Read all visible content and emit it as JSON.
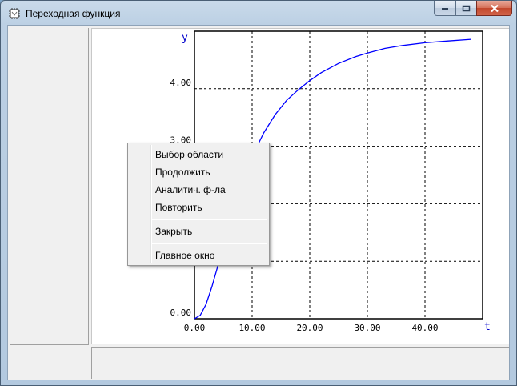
{
  "window": {
    "title": "Переходная функция",
    "icon": "chip-app-icon",
    "controls": [
      "minimize-icon",
      "maximize-icon",
      "close-icon"
    ]
  },
  "chart_data": {
    "type": "line",
    "xlabel": "t",
    "ylabel": "y",
    "xlim": [
      0,
      50
    ],
    "ylim": [
      0,
      5
    ],
    "x_ticks": [
      "0.00",
      "10.00",
      "20.00",
      "30.00",
      "40.00"
    ],
    "y_ticks": [
      "0.00",
      "3.00",
      "4.00"
    ],
    "grid": true,
    "line_color": "#0000ff",
    "series": [
      {
        "x": [
          0,
          1,
          2,
          3,
          4,
          5,
          6,
          8,
          10,
          12,
          14,
          16,
          18,
          20,
          22,
          25,
          28,
          30,
          33,
          36,
          40,
          44,
          48
        ],
        "values": [
          0.0,
          0.06,
          0.25,
          0.55,
          0.9,
          1.27,
          1.63,
          2.29,
          2.82,
          3.23,
          3.55,
          3.8,
          3.98,
          4.14,
          4.28,
          4.44,
          4.56,
          4.62,
          4.7,
          4.75,
          4.8,
          4.83,
          4.86
        ]
      }
    ]
  },
  "context_menu": {
    "items": [
      {
        "label": "Выбор области"
      },
      {
        "label": "Продолжить"
      },
      {
        "label": "Аналитич. ф-ла"
      },
      {
        "label": "Повторить"
      },
      {
        "label": "Закрыть"
      },
      {
        "label": "Главное окно"
      }
    ]
  }
}
